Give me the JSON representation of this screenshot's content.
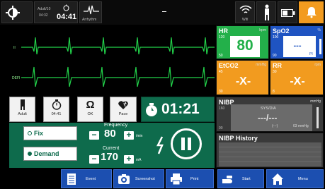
{
  "topbar": {
    "settings_icon": "gear-brightness-icon",
    "adult_small_line1": "Adult/10",
    "adult_small_line2": "04:32",
    "timer": "04:41",
    "timer_icon": "stopwatch-icon",
    "ecg_icon_caption": "Arrhythm",
    "wifi_caption": "Wifi",
    "wifi_icon": "wifi-icon",
    "person_icon": "person-icon",
    "battery_icon": "battery-icon",
    "alarm_icon": "alarm-bell-icon"
  },
  "ecg": {
    "lead1_label": "II",
    "lead2_label": "DEFI"
  },
  "vitals": {
    "hr": {
      "label": "HR",
      "unit": "bpm",
      "high": "120",
      "low": "50",
      "value": "80",
      "color": "#23b04a"
    },
    "spo2": {
      "label": "SpO2",
      "unit": "%",
      "high": "100",
      "low": "90",
      "value": "---",
      "pi_label": "PI",
      "color": "#1f54c2"
    },
    "etco2": {
      "label": "EtCO2",
      "unit": "mmHg",
      "high": "45",
      "low": "30",
      "value": "-X-",
      "color": "#f29b1f"
    },
    "rr": {
      "label": "RR",
      "unit": "rpm",
      "high": "30",
      "low": "8",
      "value": "-X-",
      "color": "#f29b1f"
    }
  },
  "nibp": {
    "label": "NIBP",
    "unit": "mmHg",
    "high": "160",
    "low": "90",
    "sys_dia_label": "SYS/DIA",
    "value": "---/---",
    "map_text": "(---)",
    "map_unit": "03 mmHg",
    "history_label": "NIBP History"
  },
  "controls": {
    "adult": {
      "label": "Adult",
      "icon": "person-icon"
    },
    "timer": {
      "label": "04:41",
      "icon": "stopwatch-icon"
    },
    "ok": {
      "label": "OK",
      "icon": "ohm-icon"
    },
    "pace": {
      "label": "Pace",
      "icon": "pacing-heart-icon"
    },
    "pace_timer": "01:21",
    "pace_timer_icon": "pacing-timer-icon"
  },
  "pacing": {
    "fix_label": "Fix",
    "demand_label": "Demand",
    "mode_selected": "Demand",
    "frequency_label": "Frequency",
    "frequency_value": "80",
    "frequency_unit": "/min",
    "current_label": "Current",
    "current_value": "170",
    "current_unit": "mA",
    "bolt_icon": "lightning-bolt-icon",
    "pause_icon": "pause-icon"
  },
  "bottombar": {
    "event": {
      "label": "Event",
      "icon": "event-list-icon"
    },
    "screenshot": {
      "label": "Screenshot",
      "icon": "camera-icon"
    },
    "print": {
      "label": "Print",
      "icon": "printer-icon"
    },
    "start": {
      "label": "Start",
      "icon": "start-hand-icon"
    },
    "menu": {
      "label": "Menu",
      "icon": "home-icon"
    }
  }
}
